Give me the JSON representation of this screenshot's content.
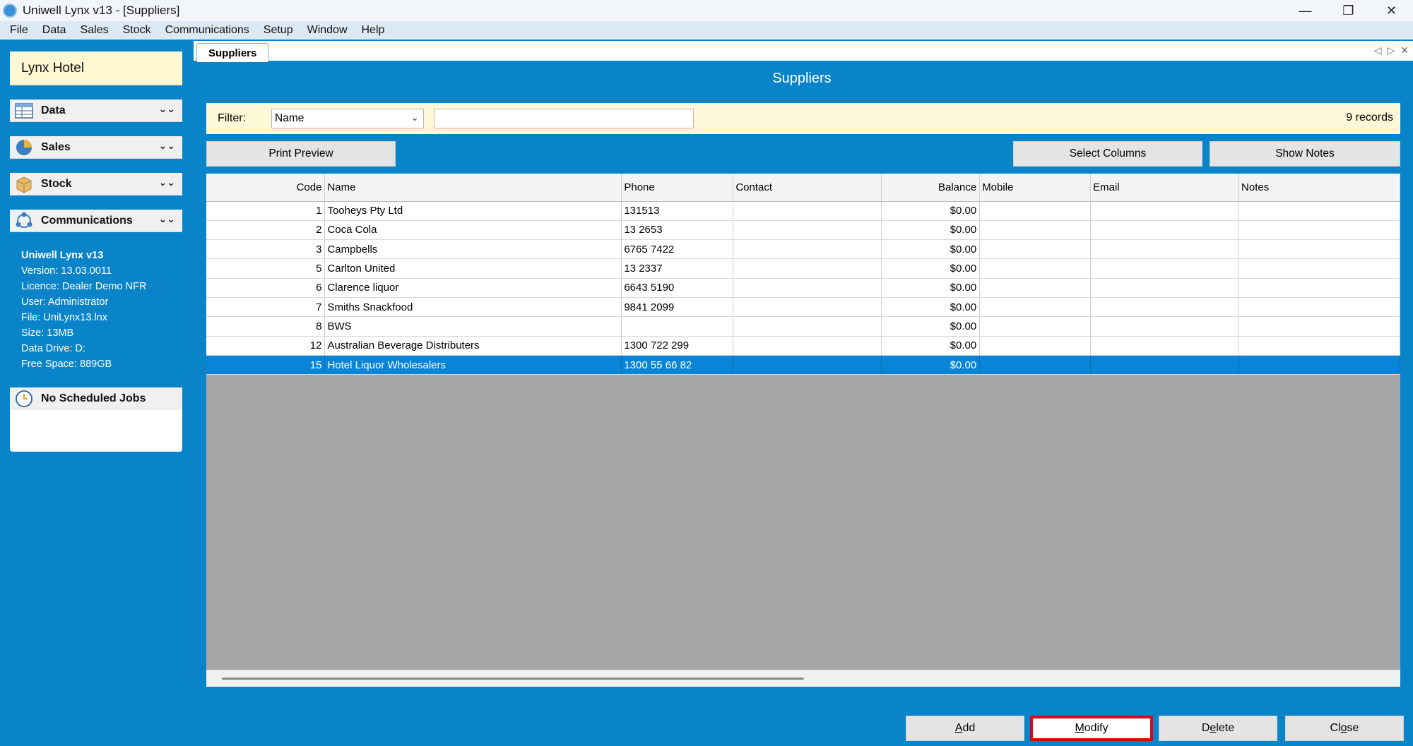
{
  "window": {
    "title": "Uniwell Lynx v13 - [Suppliers]",
    "minimize": "—",
    "restore": "❐",
    "close": "✕"
  },
  "menu": [
    "File",
    "Data",
    "Sales",
    "Stock",
    "Communications",
    "Setup",
    "Window",
    "Help"
  ],
  "sidebar": {
    "hotel_name": "Lynx Hotel",
    "sections": [
      {
        "label": "Data",
        "icon": "table-icon"
      },
      {
        "label": "Sales",
        "icon": "pie-chart-icon"
      },
      {
        "label": "Stock",
        "icon": "box-icon"
      },
      {
        "label": "Communications",
        "icon": "network-icon"
      }
    ],
    "info": {
      "product": "Uniwell Lynx v13",
      "version": "Version: 13.03.0011",
      "licence": "Licence: Dealer Demo NFR",
      "user": "User: Administrator",
      "file": "File: UniLynx13.lnx",
      "size": "Size: 13MB",
      "drive": "Data Drive: D:",
      "free": "Free Space: 889GB"
    },
    "jobs": "No Scheduled Jobs"
  },
  "tab": {
    "label": "Suppliers",
    "prev": "◁",
    "next": "▷",
    "close": "✕"
  },
  "main": {
    "heading": "Suppliers",
    "filter_label": "Filter:",
    "filter_value": "Name",
    "filter_text": "",
    "records": "9 records",
    "print_preview": "Print Preview",
    "select_columns": "Select Columns",
    "show_notes": "Show Notes"
  },
  "table": {
    "columns": [
      "Code",
      "Name",
      "Phone",
      "Contact",
      "Balance",
      "Mobile",
      "Email",
      "Notes"
    ],
    "rows": [
      [
        "1",
        "Tooheys Pty Ltd",
        "131513",
        "",
        "$0.00",
        "",
        "",
        ""
      ],
      [
        "2",
        "Coca Cola",
        "13 2653",
        "",
        "$0.00",
        "",
        "",
        ""
      ],
      [
        "3",
        "Campbells",
        "6765 7422",
        "",
        "$0.00",
        "",
        "",
        ""
      ],
      [
        "5",
        "Carlton United",
        "13 2337",
        "",
        "$0.00",
        "",
        "",
        ""
      ],
      [
        "6",
        "Clarence liquor",
        "6643 5190",
        "",
        "$0.00",
        "",
        "",
        ""
      ],
      [
        "7",
        "Smiths Snackfood",
        "9841 2099",
        "",
        "$0.00",
        "",
        "",
        ""
      ],
      [
        "8",
        "BWS",
        "",
        "",
        "$0.00",
        "",
        "",
        ""
      ],
      [
        "12",
        "Australian Beverage Distributers",
        "1300 722 299",
        "",
        "$0.00",
        "",
        "",
        ""
      ],
      [
        "15",
        "Hotel Liquor Wholesalers",
        "1300 55 66 82",
        "",
        "$0.00",
        "",
        "",
        ""
      ]
    ],
    "selected_row": 8
  },
  "buttons": {
    "add_first": "A",
    "add_rest": "dd",
    "modify_first": "M",
    "modify_rest": "odify",
    "delete_first": "D",
    "delete_mid": "e",
    "delete_rest": "lete",
    "close_first": "Cl",
    "close_mid": "o",
    "close_rest": "se"
  },
  "colors": {
    "accent": "#0a84c8",
    "selected": "#0a84d6",
    "focus_border": "#e0001a"
  }
}
